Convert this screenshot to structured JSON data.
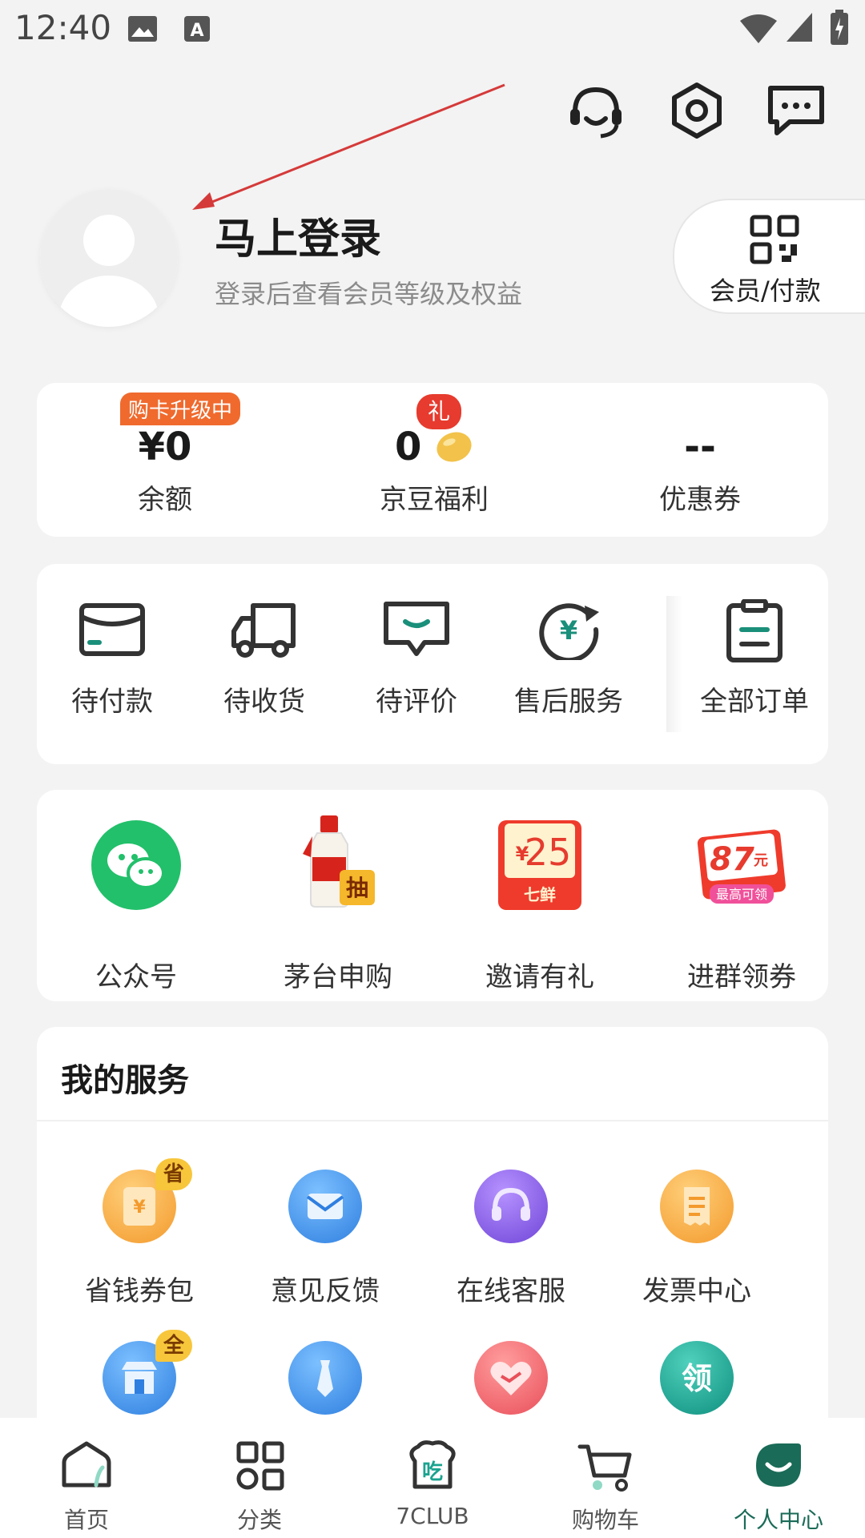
{
  "status_bar": {
    "time": "12:40"
  },
  "header": {
    "login_title": "马上登录",
    "login_subtitle": "登录后查看会员等级及权益",
    "member_pay_label": "会员/付款"
  },
  "assets": {
    "items": [
      {
        "value": "¥0",
        "label": "余额",
        "badge": "购卡升级中"
      },
      {
        "value": "0",
        "label": "京豆福利",
        "badge": "礼"
      },
      {
        "value": "--",
        "label": "优惠券"
      }
    ]
  },
  "orders": {
    "items": [
      {
        "label": "待付款",
        "icon": "wallet-icon"
      },
      {
        "label": "待收货",
        "icon": "truck-icon"
      },
      {
        "label": "待评价",
        "icon": "review-icon"
      },
      {
        "label": "售后服务",
        "icon": "refund-icon"
      },
      {
        "label": "全部订单",
        "icon": "clipboard-icon"
      }
    ]
  },
  "promos": {
    "items": [
      {
        "label": "公众号",
        "icon": "wechat-icon"
      },
      {
        "label": "茅台申购",
        "icon": "moutai-icon",
        "tag": "抽"
      },
      {
        "label": "邀请有礼",
        "icon": "invite-coupon-icon",
        "amount": "25",
        "brand": "七鲜",
        "currency": "¥"
      },
      {
        "label": "进群领券",
        "icon": "group-coupon-icon",
        "amount": "87",
        "unit": "元",
        "note": "最高可领"
      }
    ]
  },
  "services": {
    "title": "我的服务",
    "items": [
      {
        "label": "省钱券包",
        "icon": "coupon-wallet-icon",
        "tag": "省",
        "color": "#f7a53c"
      },
      {
        "label": "意见反馈",
        "icon": "mail-icon",
        "color": "#3d8fe8"
      },
      {
        "label": "在线客服",
        "icon": "headset-icon",
        "color": "#8a5fe0"
      },
      {
        "label": "发票中心",
        "icon": "invoice-icon",
        "color": "#f7a53c"
      },
      {
        "label": "",
        "icon": "store-icon",
        "tag": "全",
        "color": "#3d8fe8"
      },
      {
        "label": "",
        "icon": "tie-icon",
        "color": "#3d8fe8"
      },
      {
        "label": "",
        "icon": "heart-handshake-icon",
        "color": "#f06a6a"
      },
      {
        "label": "",
        "icon": "claim-icon",
        "text": "领",
        "color": "#1aa38f"
      }
    ]
  },
  "tabbar": {
    "items": [
      {
        "label": "首页",
        "icon": "home-icon"
      },
      {
        "label": "分类",
        "icon": "category-icon"
      },
      {
        "label": "7CLUB",
        "icon": "7club-icon",
        "glyph": "吃"
      },
      {
        "label": "购物车",
        "icon": "cart-icon"
      },
      {
        "label": "个人中心",
        "icon": "profile-icon",
        "active": true
      }
    ]
  },
  "colors": {
    "accent": "#1a6b57",
    "orange": "#f06a2e",
    "red": "#e63b2e"
  }
}
